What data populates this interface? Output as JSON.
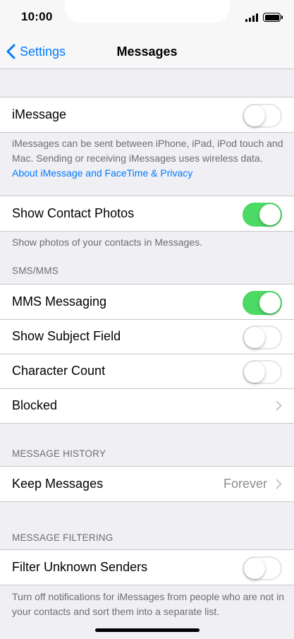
{
  "status": {
    "time": "10:00"
  },
  "nav": {
    "back_label": "Settings",
    "title": "Messages"
  },
  "imessage": {
    "label": "iMessage",
    "enabled": false,
    "footer_text": "iMessages can be sent between iPhone, iPad, iPod touch and Mac. Sending or receiving iMessages uses wireless data. ",
    "footer_link": "About iMessage and FaceTime & Privacy"
  },
  "contact_photos": {
    "label": "Show Contact Photos",
    "enabled": true,
    "footer_text": "Show photos of your contacts in Messages."
  },
  "sms_mms": {
    "header": "SMS/MMS",
    "mms_label": "MMS Messaging",
    "mms_enabled": true,
    "subject_label": "Show Subject Field",
    "subject_enabled": false,
    "char_count_label": "Character Count",
    "char_count_enabled": false,
    "blocked_label": "Blocked"
  },
  "history": {
    "header": "MESSAGE HISTORY",
    "keep_label": "Keep Messages",
    "keep_value": "Forever"
  },
  "filtering": {
    "header": "MESSAGE FILTERING",
    "filter_label": "Filter Unknown Senders",
    "filter_enabled": false,
    "footer_text": "Turn off notifications for iMessages from people who are not in your contacts and sort them into a separate list."
  },
  "colors": {
    "accent": "#007aff",
    "toggle_on": "#4cd964",
    "background": "#efeff4",
    "secondary_text": "#6d6d72"
  },
  "icons": [
    "back-chevron-icon",
    "chevron-right-icon",
    "signal-icon",
    "battery-icon"
  ]
}
